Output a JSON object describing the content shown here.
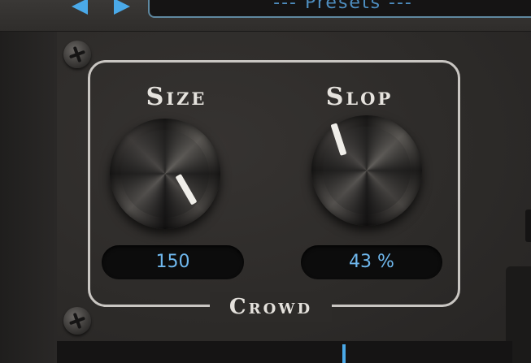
{
  "toolbar": {
    "prev_icon": "triangle-left-icon",
    "next_icon": "triangle-right-icon",
    "preset_label": "--- Presets ---"
  },
  "group": {
    "label": "Crowd"
  },
  "knobs": [
    {
      "title": "Size",
      "value": "150"
    },
    {
      "title": "Slop",
      "value": "43 %"
    }
  ],
  "colors": {
    "accent": "#4aa9e8",
    "value_text": "#6fb8ee",
    "frame": "#c9c6c2",
    "panel": "#2d2b29"
  }
}
